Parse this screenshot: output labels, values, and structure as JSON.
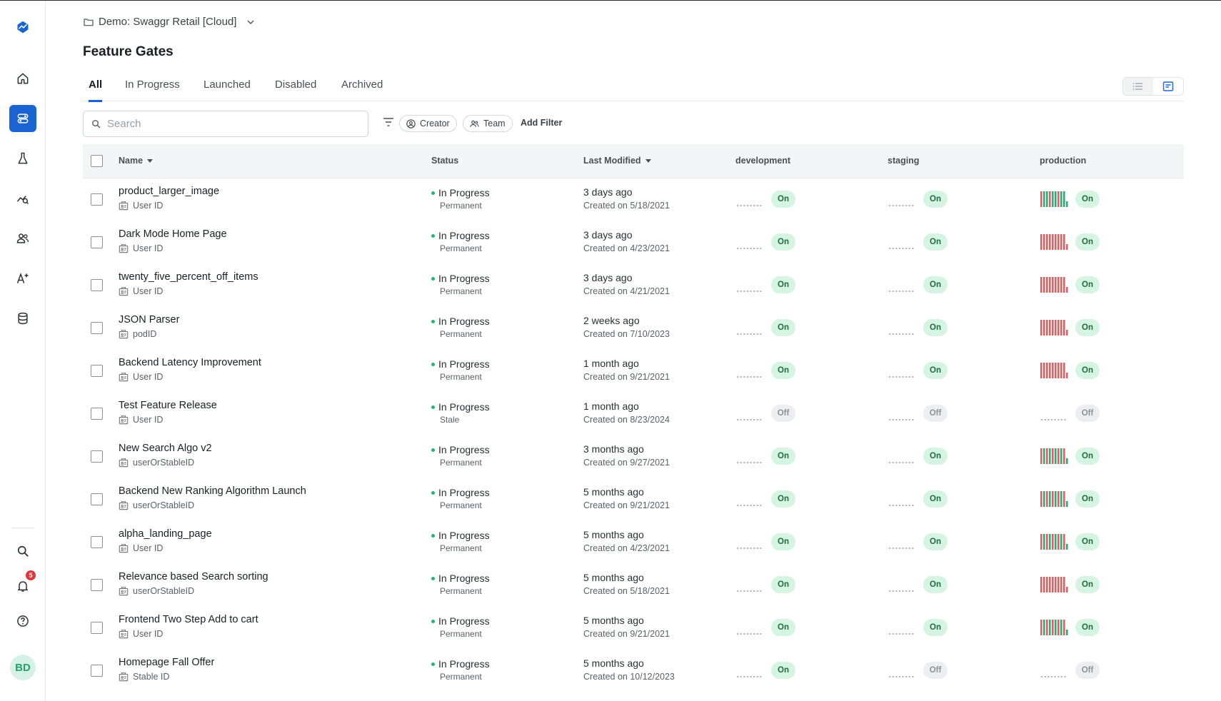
{
  "sidebar": {
    "nav": [
      "logo-icon",
      "home-icon",
      "feature-gates-icon",
      "experiments-icon",
      "analytics-icon",
      "users-icon",
      "autotune-icon",
      "database-icon"
    ],
    "bottom": [
      "search-icon",
      "bell-icon",
      "help-icon"
    ],
    "notification_count": "5",
    "avatar_initials": "BD"
  },
  "header": {
    "project": "Demo: Swaggr Retail [Cloud]",
    "title": "Feature Gates"
  },
  "tabs": [
    "All",
    "In Progress",
    "Launched",
    "Disabled",
    "Archived"
  ],
  "active_tab": "All",
  "search": {
    "placeholder": "Search"
  },
  "filters": {
    "creator": "Creator",
    "team": "Team",
    "add": "Add Filter"
  },
  "table": {
    "columns": {
      "name": "Name",
      "status": "Status",
      "modified": "Last Modified",
      "dev": "development",
      "staging": "staging",
      "prod": "production"
    },
    "rows": [
      {
        "name": "product_larger_image",
        "id": "User ID",
        "status": "In Progress",
        "sub": "Permanent",
        "modified": "3 days ago",
        "created": "Created on 5/18/2021",
        "dev": "On",
        "staging": "On",
        "prod": "On",
        "chart": "green"
      },
      {
        "name": "Dark Mode Home Page",
        "id": "User ID",
        "status": "In Progress",
        "sub": "Permanent",
        "modified": "3 days ago",
        "created": "Created on 4/23/2021",
        "dev": "On",
        "staging": "On",
        "prod": "On",
        "chart": "red"
      },
      {
        "name": "twenty_five_percent_off_items",
        "id": "User ID",
        "status": "In Progress",
        "sub": "Permanent",
        "modified": "3 days ago",
        "created": "Created on 4/21/2021",
        "dev": "On",
        "staging": "On",
        "prod": "On",
        "chart": "red"
      },
      {
        "name": "JSON Parser",
        "id": "podID",
        "status": "In Progress",
        "sub": "Permanent",
        "modified": "2 weeks ago",
        "created": "Created on 7/10/2023",
        "dev": "On",
        "staging": "On",
        "prod": "On",
        "chart": "red"
      },
      {
        "name": "Backend Latency Improvement",
        "id": "User ID",
        "status": "In Progress",
        "sub": "Permanent",
        "modified": "1 month ago",
        "created": "Created on 9/21/2021",
        "dev": "On",
        "staging": "On",
        "prod": "On",
        "chart": "red"
      },
      {
        "name": "Test Feature Release",
        "id": "User ID",
        "status": "In Progress",
        "sub": "Stale",
        "modified": "1 month ago",
        "created": "Created on 8/23/2024",
        "dev": "Off",
        "staging": "Off",
        "prod": "Off",
        "chart": "none"
      },
      {
        "name": "New Search Algo v2",
        "id": "userOrStableID",
        "status": "In Progress",
        "sub": "Permanent",
        "modified": "3 months ago",
        "created": "Created on 9/27/2021",
        "dev": "On",
        "staging": "On",
        "prod": "On",
        "chart": "mixed"
      },
      {
        "name": "Backend New Ranking Algorithm Launch",
        "id": "userOrStableID",
        "status": "In Progress",
        "sub": "Permanent",
        "modified": "5 months ago",
        "created": "Created on 9/21/2021",
        "dev": "On",
        "staging": "On",
        "prod": "On",
        "chart": "mixed"
      },
      {
        "name": "alpha_landing_page",
        "id": "User ID",
        "status": "In Progress",
        "sub": "Permanent",
        "modified": "5 months ago",
        "created": "Created on 4/23/2021",
        "dev": "On",
        "staging": "On",
        "prod": "On",
        "chart": "mixed"
      },
      {
        "name": "Relevance based Search sorting",
        "id": "userOrStableID",
        "status": "In Progress",
        "sub": "Permanent",
        "modified": "5 months ago",
        "created": "Created on 5/18/2021",
        "dev": "On",
        "staging": "On",
        "prod": "On",
        "chart": "red"
      },
      {
        "name": "Frontend Two Step Add to cart",
        "id": "User ID",
        "status": "In Progress",
        "sub": "Permanent",
        "modified": "5 months ago",
        "created": "Created on 9/21/2021",
        "dev": "On",
        "staging": "On",
        "prod": "On",
        "chart": "mixed"
      },
      {
        "name": "Homepage Fall Offer",
        "id": "Stable ID",
        "status": "In Progress",
        "sub": "Permanent",
        "modified": "5 months ago",
        "created": "Created on 10/12/2023",
        "dev": "On",
        "staging": "Off",
        "prod": "Off",
        "chart": "none"
      }
    ]
  },
  "colors": {
    "accent": "#1963d2",
    "on_bg": "#d6f4e2",
    "off_bg": "#eceef1",
    "spark_red": "#ef5a5a",
    "spark_green": "#21b573",
    "status_dot": "#2db36f"
  }
}
